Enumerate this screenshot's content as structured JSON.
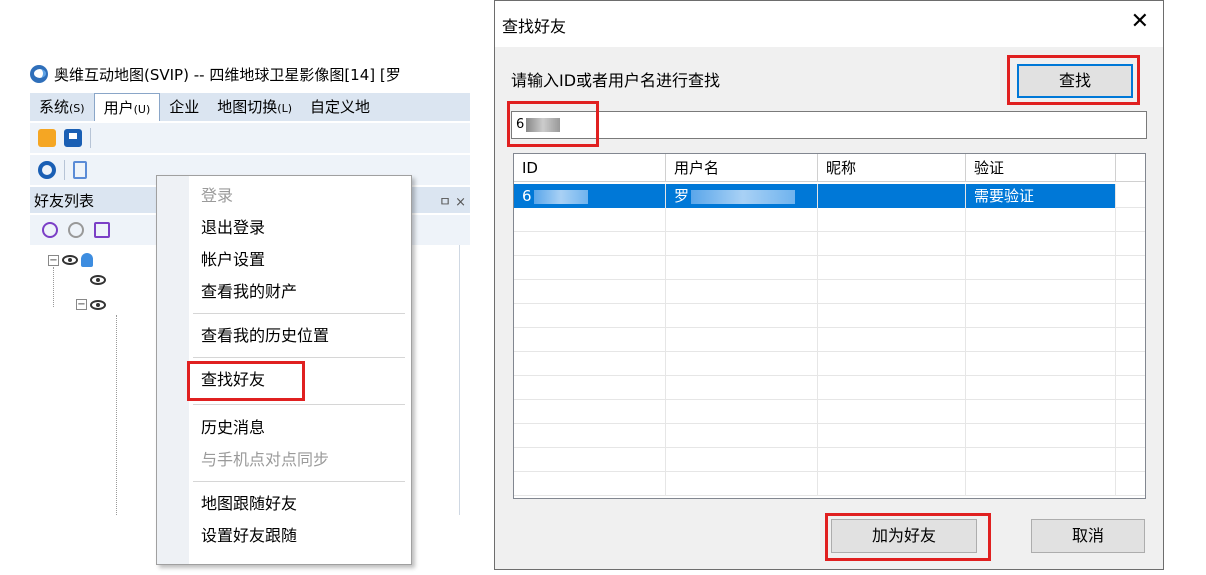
{
  "main_window": {
    "title": "奥维互动地图(SVIP) -- 四维地球卫星影像图[14] [罗",
    "menu": [
      {
        "label": "系统",
        "key": "(S)"
      },
      {
        "label": "用户",
        "key": "(U)"
      },
      {
        "label": "企业",
        "key": ""
      },
      {
        "label": "地图切换",
        "key": "(L)"
      },
      {
        "label": "自定义地",
        "key": ""
      }
    ],
    "panel_title": "好友列表",
    "panel_controls": "ㅁ ×"
  },
  "user_menu": {
    "items": [
      {
        "label": "登录",
        "disabled": true
      },
      {
        "label": "退出登录",
        "disabled": false
      },
      {
        "label": "帐户设置",
        "disabled": false
      },
      {
        "label": "查看我的财产",
        "disabled": false
      },
      {
        "label": "查看我的历史位置",
        "disabled": false
      },
      {
        "label": "查找好友",
        "disabled": false
      },
      {
        "label": "历史消息",
        "disabled": false
      },
      {
        "label": "与手机点对点同步",
        "disabled": true
      },
      {
        "label": "地图跟随好友",
        "disabled": false
      },
      {
        "label": "设置好友跟随",
        "disabled": false
      }
    ]
  },
  "find_friend_dialog": {
    "title": "查找好友",
    "close_glyph": "✕",
    "prompt": "请输入ID或者用户名进行查找",
    "search_button": "查找",
    "search_value": "6",
    "columns": [
      "ID",
      "用户名",
      "昵称",
      "验证"
    ],
    "rows": [
      {
        "id": "6",
        "username": "罗",
        "nickname": "",
        "verify": "需要验证"
      }
    ],
    "add_button": "加为好友",
    "cancel_button": "取消"
  },
  "colors": {
    "highlight_red": "#e02020",
    "selection_blue": "#0078d7",
    "menubar_bg": "#dbe5f1"
  }
}
